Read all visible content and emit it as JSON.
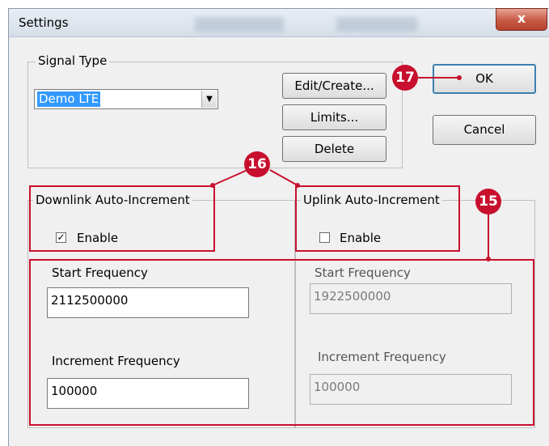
{
  "window": {
    "title": "Settings",
    "close_symbol": "x"
  },
  "signal_type": {
    "group_label": "Signal Type",
    "selected": "Demo LTE",
    "dropdown_symbol": "▼"
  },
  "buttons": {
    "edit_create": "Edit/Create...",
    "limits": "Limits...",
    "delete": "Delete",
    "ok": "OK",
    "cancel": "Cancel"
  },
  "downlink": {
    "group_label": "Downlink Auto-Increment",
    "enable_label": "Enable",
    "enable_checked": true,
    "check_mark": "✓",
    "start_label": "Start Frequency",
    "start_value": "2112500000",
    "increment_label": "Increment Frequency",
    "increment_value": "100000"
  },
  "uplink": {
    "group_label": "Uplink Auto-Increment",
    "enable_label": "Enable",
    "enable_checked": false,
    "start_label": "Start Frequency",
    "start_value": "1922500000",
    "increment_label": "Increment Frequency",
    "increment_value": "100000"
  },
  "callouts": {
    "c15": "15",
    "c16": "16",
    "c17": "17"
  },
  "colors": {
    "callout": "#c8102e",
    "selection": "#3399ff"
  }
}
